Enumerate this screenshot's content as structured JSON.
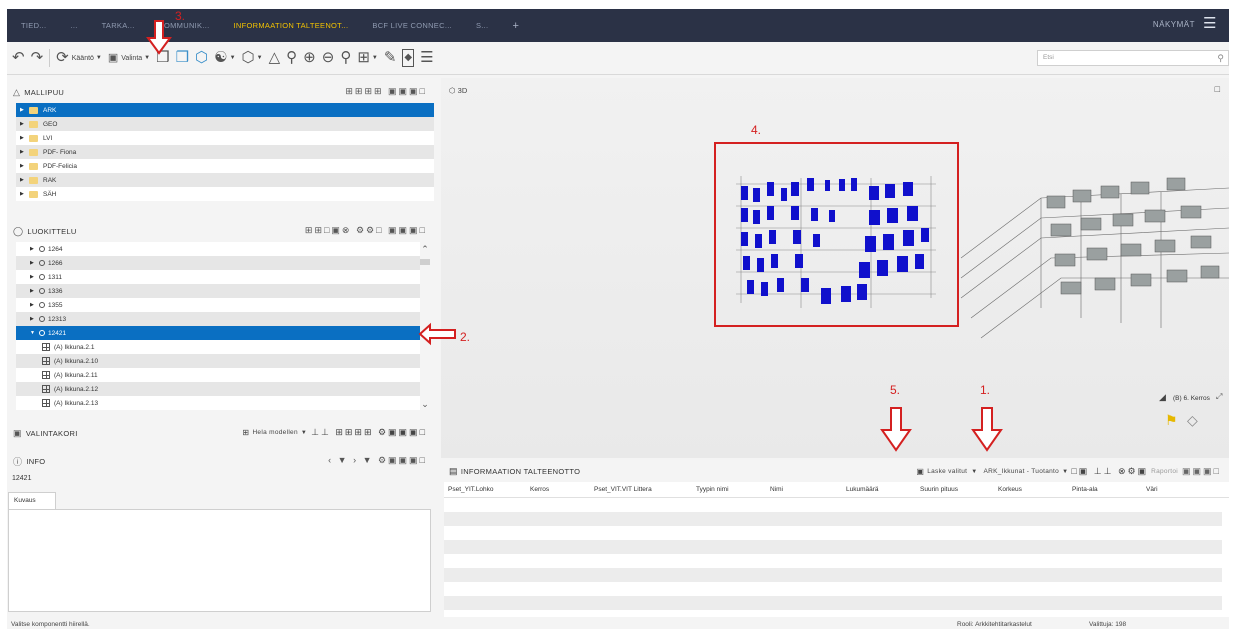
{
  "tabs": [
    {
      "label": "TIED...",
      "active": false
    },
    {
      "label": "...",
      "active": false
    },
    {
      "label": "TARKA...",
      "active": false
    },
    {
      "label": "KOMMUNIK...",
      "active": false
    },
    {
      "label": "INFORMAATION TALTEENOT...",
      "active": true
    },
    {
      "label": "BCF LIVE CONNEC...",
      "active": false
    },
    {
      "label": "S...",
      "active": false
    }
  ],
  "tab_add": "+",
  "views_label": "NÄKYMÄT",
  "toolbar": {
    "rotate_label": "Kääntö",
    "select_label": "Valinta",
    "search_placeholder": "Etsi"
  },
  "model_tree": {
    "title": "MALLIPUU",
    "items": [
      "ARK",
      "GEO",
      "LVI",
      "PDF- Fiona",
      "PDF-Felicia",
      "RAK",
      "SÄH"
    ],
    "selected_index": 0
  },
  "classification": {
    "title": "LUOKITTELU",
    "items": [
      "1264",
      "1266",
      "1311",
      "1336",
      "1355",
      "12313",
      "12421"
    ],
    "selected_index": 6,
    "children": [
      "(A) Ikkuna.2.1",
      "(A) Ikkuna.2.10",
      "(A) Ikkuna.2.11",
      "(A) Ikkuna.2.12",
      "(A) Ikkuna.2.13"
    ]
  },
  "basket": {
    "title": "VALINTAKORI",
    "scope_label": "Hela modellen"
  },
  "info": {
    "title": "INFO",
    "value": "12421",
    "tab_label": "Kuvaus"
  },
  "viewport": {
    "label": "3D",
    "floor_label": "(B) 6. Kerros"
  },
  "extraction": {
    "title": "INFORMAATION TALTEENOTTO",
    "count_label": "Laske valitut",
    "template_label": "ARK_Ikkunat - Tuotanto",
    "report_label": "Raportoi",
    "columns": [
      "Pset_YIT.Lohko",
      "Kerros",
      "Pset_VIT.VIT Littera",
      "Tyypin nimi",
      "Nimi",
      "Lukumäärä",
      "Suurin pituus",
      "Korkeus",
      "Pinta-ala",
      "Väri"
    ]
  },
  "status": {
    "hint": "Valitse komponentti hiirellä.",
    "role": "Rooli: Arkkitehtitarkastelut",
    "selected": "Valittuja: 198"
  },
  "annotations": [
    "1.",
    "2.",
    "3.",
    "4.",
    "5."
  ],
  "colors": {
    "accent": "#f2c200",
    "selection": "#0a6fc2",
    "annotation": "#d42020",
    "window_blue": "#1010cc"
  }
}
